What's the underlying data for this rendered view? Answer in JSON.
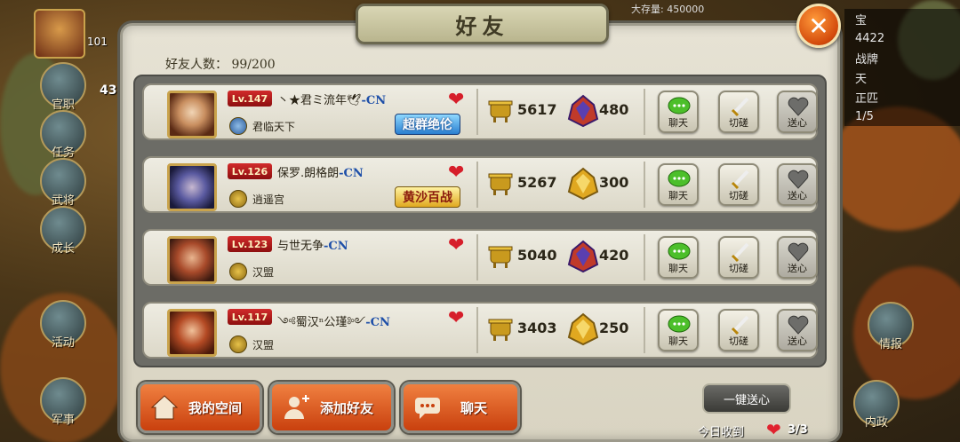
{
  "hud": {
    "top_left_value": "101",
    "left_number": "43",
    "treasury_label": "大存量",
    "treasury_value": "450000",
    "right_stats": [
      "宝",
      "4422",
      "战牌",
      "天",
      "正匹",
      "1/5"
    ]
  },
  "side_menu": [
    {
      "label": "官职"
    },
    {
      "label": "任务"
    },
    {
      "label": "武将"
    },
    {
      "label": "成长"
    },
    {
      "label": "活动"
    },
    {
      "label": "军事"
    }
  ],
  "right_menu": [
    {
      "label": "情报"
    },
    {
      "label": "内政"
    }
  ],
  "panel": {
    "title": "好友",
    "close_icon": "close-x-icon",
    "friend_count_label": "好友人数：",
    "friend_count_value": "99/200"
  },
  "friends": [
    {
      "level": "Lv.147",
      "name": "丶★君ミ流年🕊",
      "server": "-CN",
      "guild": "君临天下",
      "title_badge": "超群绝伦",
      "title_style": "blue",
      "power": "5617",
      "rank_value": "480",
      "rank_icon_color": "#c03a2a"
    },
    {
      "level": "Lv.126",
      "name": "保罗.朗格朗",
      "server": "-CN",
      "guild": "逍遥宫",
      "title_badge": "黄沙百战",
      "title_style": "gold",
      "power": "5267",
      "rank_value": "300",
      "rank_icon_color": "#d8a21c"
    },
    {
      "level": "Lv.123",
      "name": "与世无争",
      "server": "-CN",
      "guild": "汉盟",
      "title_badge": "",
      "title_style": "",
      "power": "5040",
      "rank_value": "420",
      "rank_icon_color": "#c03a2a"
    },
    {
      "level": "Lv.117",
      "name": "༺蜀汉ⁿ公瑾༻",
      "server": "-CN",
      "guild": "汉盟",
      "title_badge": "",
      "title_style": "",
      "power": "3403",
      "rank_value": "250",
      "rank_icon_color": "#d8a21c"
    }
  ],
  "row_actions": {
    "chat": "聊天",
    "spar": "切磋",
    "send_heart": "送心"
  },
  "bottom": {
    "my_space": "我的空间",
    "add_friend": "添加好友",
    "chat": "聊天",
    "one_key_send": "一键送心",
    "today_received_label": "今日收到",
    "today_received_value": "3/3"
  },
  "colors": {
    "accent_orange": "#d9541a",
    "heart_red": "#d61e2a",
    "server_blue": "#1e4fa8",
    "level_red": "#c41f1f"
  }
}
